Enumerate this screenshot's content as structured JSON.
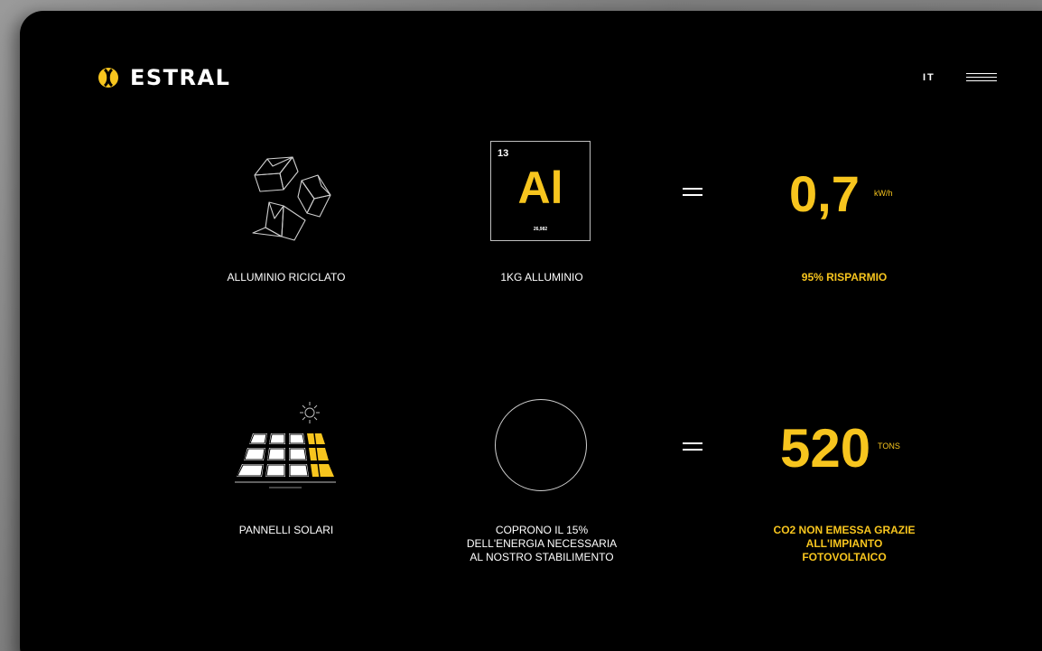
{
  "header": {
    "brand": "ESTRAL",
    "language": "IT",
    "menu_icon": "hamburger-menu-icon"
  },
  "colors": {
    "accent": "#f7c51e",
    "background": "#000000",
    "text": "#ffffff"
  },
  "row1": {
    "left_icon": "recycle-icon",
    "left_caption": "ALLUMINIO RICICLATO",
    "element": {
      "atomic_number": "13",
      "symbol": "Al",
      "atomic_mass": "26,982"
    },
    "middle_caption": "1KG ALLUMINIO",
    "equals_icon": "equals-icon",
    "value": "0,7",
    "unit": "kW/h",
    "right_caption": "95% RISPARMIO"
  },
  "row2": {
    "left_icon": "solar-panel-icon",
    "sun_icon": "sun-icon",
    "left_caption": "PANNELLI SOLARI",
    "circle_icon": "circle-icon",
    "middle_caption_lines": [
      "COPRONO IL 15%",
      "DELL'ENERGIA NECESSARIA",
      "AL NOSTRO STABILIMENTO"
    ],
    "equals_icon": "equals-icon",
    "value": "520",
    "unit": "TONS",
    "right_caption_lines": [
      "CO2 NON EMESSA GRAZIE",
      "ALL'IMPIANTO",
      "FOTOVOLTAICO"
    ]
  }
}
